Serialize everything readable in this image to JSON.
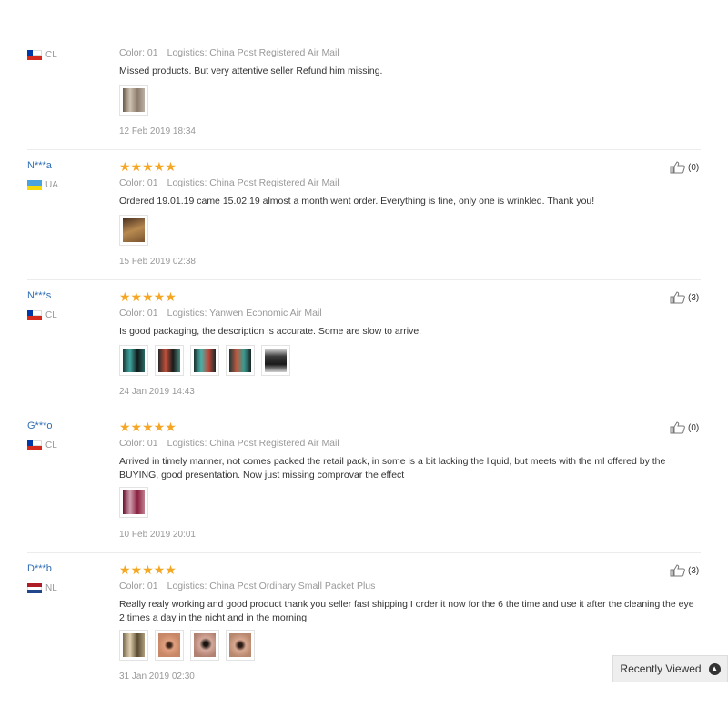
{
  "reviews": [
    {
      "user": "",
      "country": "CL",
      "stars": "",
      "color": "Color: 01",
      "logistics": "Logistics: China Post Registered Air Mail",
      "text": "Missed products. But very attentive seller Refund him missing.",
      "date": "12 Feb 2019 18:34",
      "helpful": ""
    },
    {
      "user": "N***a",
      "country": "UA",
      "stars": "★★★★★",
      "color": "Color: 01",
      "logistics": "Logistics: China Post Registered Air Mail",
      "text": "Ordered 19.01.19 came 15.02.19 almost a month went order. Everything is fine, only one is wrinkled. Thank you!",
      "date": "15 Feb 2019 02:38",
      "helpful": "(0)"
    },
    {
      "user": "N***s",
      "country": "CL",
      "stars": "★★★★★",
      "color": "Color: 01",
      "logistics": "Logistics: Yanwen Economic Air Mail",
      "text": "Is good packaging, the description is accurate. Some are slow to arrive.",
      "date": "24 Jan 2019 14:43",
      "helpful": "(3)"
    },
    {
      "user": "G***o",
      "country": "CL",
      "stars": "★★★★★",
      "color": "Color: 01",
      "logistics": "Logistics: China Post Registered Air Mail",
      "text": "Arrived in timely manner, not comes packed the retail pack, in some is a bit lacking the liquid, but meets with the ml offered by the BUYING, good presentation. Now just missing comprovar the effect",
      "date": "10 Feb 2019 20:01",
      "helpful": "(0)"
    },
    {
      "user": "D***b",
      "country": "NL",
      "stars": "★★★★★",
      "color": "Color: 01",
      "logistics": "Logistics: China Post Ordinary Small Packet Plus",
      "text": "Really realy working and good product thank you seller fast shipping I order it now for the 6 the time and use it after the cleaning the eye 2 times a day in the nicht and in the morning",
      "date": "31 Jan 2019 02:30",
      "helpful": "(3)"
    }
  ],
  "recently_viewed": {
    "label": "Recently Viewed"
  },
  "colors": {
    "star": "#f5a623",
    "username": "#2f6fb5",
    "meta": "#999999"
  },
  "icons": {
    "helpful": "thumbs-up-icon",
    "recent": "chevron-up-circle-icon"
  }
}
